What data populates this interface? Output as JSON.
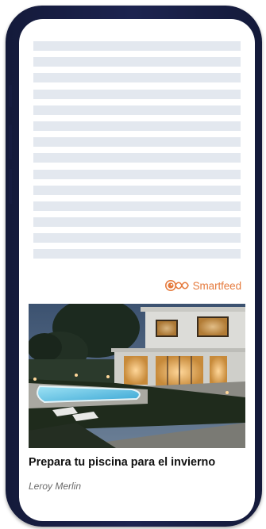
{
  "brand": {
    "name": "Smartfeed",
    "color": "#e57b3e"
  },
  "article": {
    "title": "Prepara tu piscina para el invierno",
    "source": "Leroy Merlin",
    "image_icon": "house-with-pool-photo"
  },
  "skeleton": {
    "line_count": 14,
    "color": "#e3e8ef"
  },
  "frame": {
    "color": "#1b2148"
  }
}
